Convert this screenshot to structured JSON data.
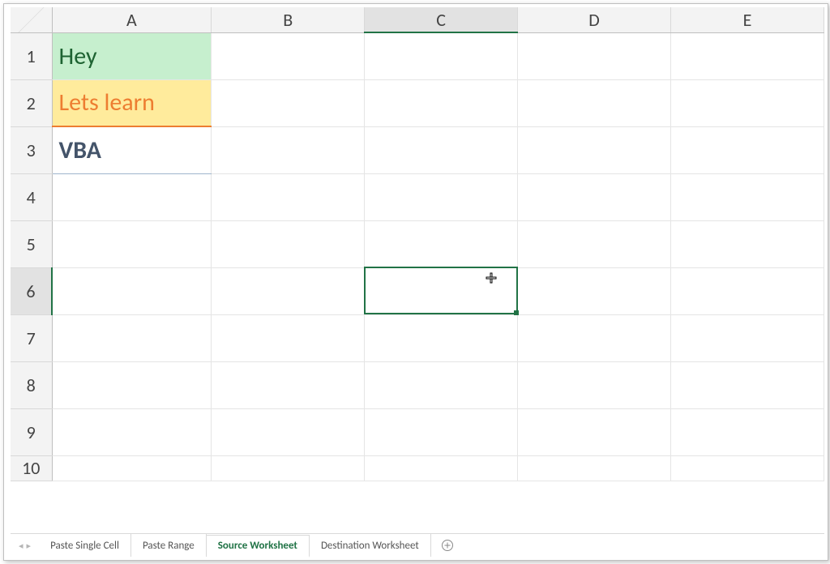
{
  "columns": [
    "A",
    "B",
    "C",
    "D",
    "E"
  ],
  "rows": [
    "1",
    "2",
    "3",
    "4",
    "5",
    "6",
    "7",
    "8",
    "9",
    "10"
  ],
  "cells": {
    "A1": "Hey",
    "A2": "Lets learn",
    "A3": "VBA"
  },
  "selection": {
    "col": "C",
    "row": "6"
  },
  "tabs": {
    "items": [
      "Paste Single Cell",
      "Paste Range",
      "Source Worksheet",
      "Destination Worksheet"
    ],
    "activeIndex": 2
  },
  "icons": {
    "nav_prev": "◂",
    "nav_next": "▸"
  }
}
